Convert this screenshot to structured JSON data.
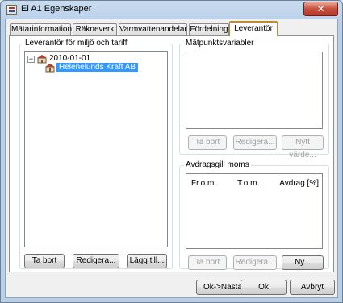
{
  "window": {
    "title": "El A1 Egenskaper",
    "close_label": "✕"
  },
  "tabs": [
    {
      "label": "Mätarinformation"
    },
    {
      "label": "Räkneverk"
    },
    {
      "label": "Varmvattenandelar"
    },
    {
      "label": "Fördelning"
    },
    {
      "label": "Leverantör",
      "active": true
    }
  ],
  "supplier": {
    "group_label": "Leverantör för miljö och tariff",
    "tree": {
      "date_node": "2010-01-01",
      "expander": "−",
      "supplier_node": "Helenelunds Kraft AB"
    },
    "buttons": {
      "remove": "Ta bort",
      "edit": "Redigera...",
      "add": "Lägg till..."
    }
  },
  "meter_vars": {
    "group_label": "Mätpunktsvariabler",
    "buttons": {
      "remove": "Ta bort",
      "edit": "Redigera...",
      "new_value": "Nytt värde..."
    }
  },
  "vat": {
    "group_label": "Avdragsgill moms",
    "columns": {
      "from": "Fr.o.m.",
      "to": "T.o.m.",
      "deduction": "Avdrag [%]"
    },
    "buttons": {
      "remove": "Ta bort",
      "edit": "Redigera...",
      "new": "Ny..."
    }
  },
  "footer": {
    "ok_next": "Ok->Nästa",
    "ok": "Ok",
    "cancel": "Avbryt"
  }
}
